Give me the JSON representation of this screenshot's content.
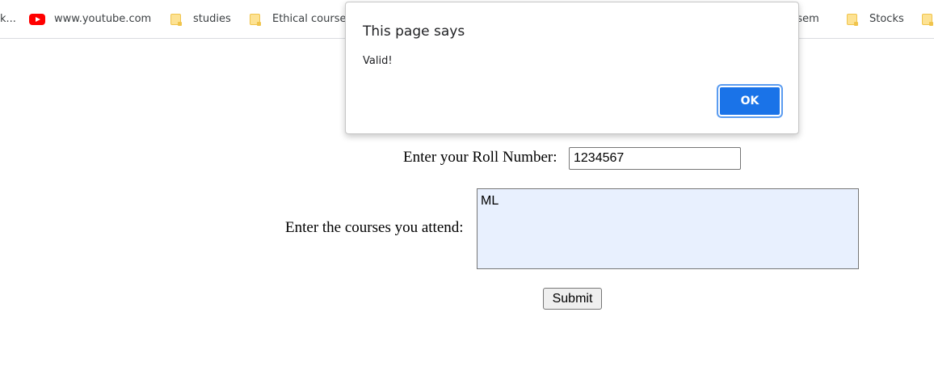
{
  "bookmarks": {
    "items": [
      {
        "label": "k...",
        "icon": "none"
      },
      {
        "label": "www.youtube.com",
        "icon": "youtube-icon"
      },
      {
        "label": "studies",
        "icon": "folder-icon"
      },
      {
        "label": "Ethical course",
        "icon": "folder-icon"
      },
      {
        "label": "h sem",
        "icon": "none"
      },
      {
        "label": "Stocks",
        "icon": "folder-icon"
      }
    ]
  },
  "form": {
    "roll_label": "Enter your Roll Number:",
    "roll_value": "1234567",
    "courses_label": "Enter the courses you attend:",
    "courses_value": "ML",
    "submit_label": "Submit"
  },
  "dialog": {
    "title": "This page says",
    "message": "Valid!",
    "ok_label": "OK",
    "accent": "#1a73e8"
  }
}
